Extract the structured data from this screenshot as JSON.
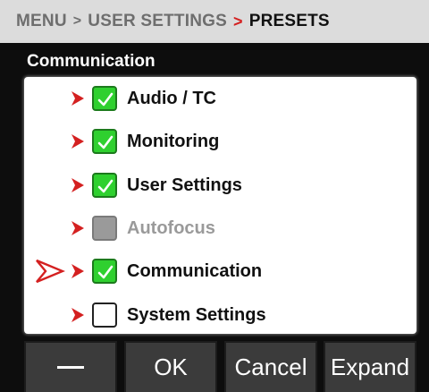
{
  "breadcrumb": {
    "menu": "MENU",
    "sep1": ">",
    "user_settings": "USER SETTINGS",
    "sep2": ">",
    "current": "PRESETS"
  },
  "section_label": "Communication",
  "items": [
    {
      "label": "Audio / TC",
      "state": "checked",
      "icon": "check-icon"
    },
    {
      "label": "Monitoring",
      "state": "checked",
      "icon": "check-icon"
    },
    {
      "label": "User Settings",
      "state": "checked",
      "icon": "check-icon"
    },
    {
      "label": "Autofocus",
      "state": "disabled",
      "icon": "none"
    },
    {
      "label": "Communication",
      "state": "checked",
      "icon": "check-icon",
      "selected": true
    },
    {
      "label": "System Settings",
      "state": "unchecked",
      "icon": "none"
    }
  ],
  "buttons": {
    "minus_icon": "minus-icon",
    "ok": "OK",
    "cancel": "Cancel",
    "expand": "Expand"
  },
  "colors": {
    "accent_red": "#d42020",
    "check_green": "#2fd02f",
    "disabled_gray": "#9a9a9a",
    "header_bg": "#dcdcdc"
  }
}
